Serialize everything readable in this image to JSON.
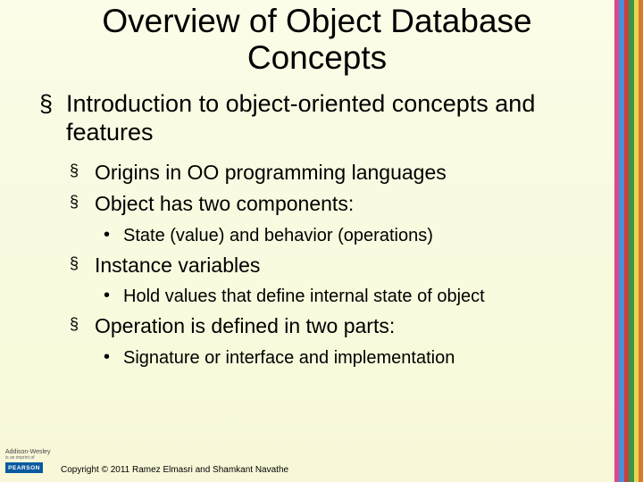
{
  "title": "Overview of Object Database Concepts",
  "main": {
    "heading": "Introduction to object-oriented concepts and features",
    "items": [
      {
        "text": "Origins in OO programming languages"
      },
      {
        "text": "Object has two components:",
        "sub": [
          "State (value) and behavior (operations)"
        ]
      },
      {
        "text": "Instance variables",
        "sub": [
          "Hold values that define internal state of object"
        ]
      },
      {
        "text": "Operation is defined in two parts:",
        "sub": [
          "Signature or interface and implementation"
        ]
      }
    ]
  },
  "footer": {
    "publisher_line1": "Addison-Wesley",
    "publisher_line2": "is an imprint of",
    "brand": "PEARSON",
    "copyright": "Copyright © 2011 Ramez Elmasri and Shamkant Navathe"
  }
}
